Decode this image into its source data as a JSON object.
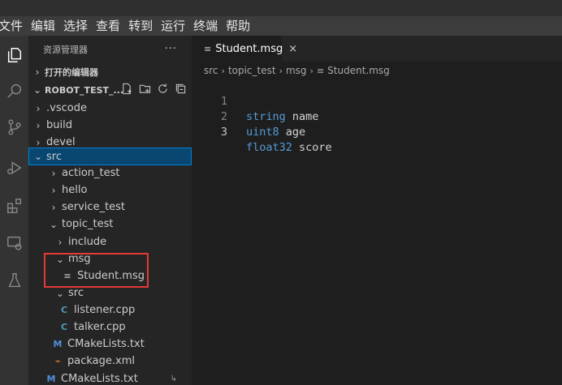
{
  "menu": [
    "文件",
    "编辑",
    "选择",
    "查看",
    "转到",
    "运行",
    "终端",
    "帮助"
  ],
  "sidebar": {
    "title": "资源管理器",
    "more": "···",
    "open_editors": "打开的编辑器",
    "workspace": "ROBOT_TEST_..."
  },
  "tree": [
    {
      "label": ".vscode",
      "type": "folder",
      "expanded": false
    },
    {
      "label": "build",
      "type": "folder",
      "expanded": false
    },
    {
      "label": "devel",
      "type": "folder",
      "expanded": false
    },
    {
      "label": "src",
      "type": "folder",
      "expanded": true,
      "selected": true
    },
    {
      "label": "action_test",
      "type": "folder",
      "expanded": false
    },
    {
      "label": "hello",
      "type": "folder",
      "expanded": false
    },
    {
      "label": "service_test",
      "type": "folder",
      "expanded": false
    },
    {
      "label": "topic_test",
      "type": "folder",
      "expanded": true
    },
    {
      "label": "include",
      "type": "folder",
      "expanded": false
    },
    {
      "label": "msg",
      "type": "folder",
      "expanded": true
    },
    {
      "label": "Student.msg",
      "type": "msg"
    },
    {
      "label": "src",
      "type": "folder",
      "expanded": true
    },
    {
      "label": "listener.cpp",
      "type": "cpp"
    },
    {
      "label": "talker.cpp",
      "type": "cpp"
    },
    {
      "label": "CMakeLists.txt",
      "type": "cmake"
    },
    {
      "label": "package.xml",
      "type": "xml"
    },
    {
      "label": "CMakeLists.txt",
      "type": "cmake"
    }
  ],
  "tree_badge": "↳",
  "editor": {
    "tab_label": "Student.msg",
    "tab_close": "×",
    "breadcrumb": [
      "src",
      "topic_test",
      "msg",
      "Student.msg"
    ],
    "lines": [
      {
        "num": "1",
        "type": "string",
        "name": "name"
      },
      {
        "num": "2",
        "type": "uint8",
        "name": "age"
      },
      {
        "num": "3",
        "type": "float32",
        "name": "score"
      }
    ]
  },
  "colors": {
    "keyword": "#569cd6",
    "selection": "#094771",
    "highlight_box": "#e53935"
  }
}
